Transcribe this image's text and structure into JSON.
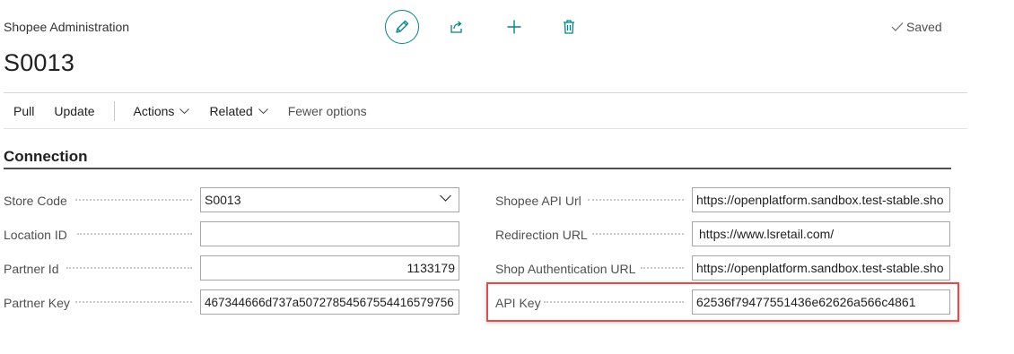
{
  "header": {
    "subtitle": "Shopee Administration",
    "record_no": "S0013",
    "saved_label": "Saved"
  },
  "toolbar": {
    "pull": "Pull",
    "update": "Update",
    "actions": "Actions",
    "related": "Related",
    "fewer": "Fewer options"
  },
  "section": {
    "title": "Connection"
  },
  "left_fields": [
    {
      "label": "Store Code",
      "value": "S0013"
    },
    {
      "label": "Location ID",
      "value": ""
    },
    {
      "label": "Partner Id",
      "value": "1133179"
    },
    {
      "label": "Partner Key",
      "value": "467344666d737a5072785456755441657975​6"
    }
  ],
  "right_fields": [
    {
      "label": "Shopee API Url",
      "value": "https://openplatform.sandbox.test-stable.sho"
    },
    {
      "label": "Redirection URL",
      "value": "https://www.lsretail.com/"
    },
    {
      "label": "Shop Authentication URL",
      "value": "https://openplatform.sandbox.test-stable.sho"
    },
    {
      "label": "API Key",
      "value": "62536f79477551436e62626a566c4861"
    }
  ],
  "icons": {
    "edit": "pencil-icon",
    "share": "share-icon",
    "add": "plus-icon",
    "delete": "trash-icon",
    "saved": "checkmark-icon",
    "dropdown": "chevron-down-icon"
  },
  "colors": {
    "accent": "#008489",
    "highlight": "#e04b4b"
  }
}
